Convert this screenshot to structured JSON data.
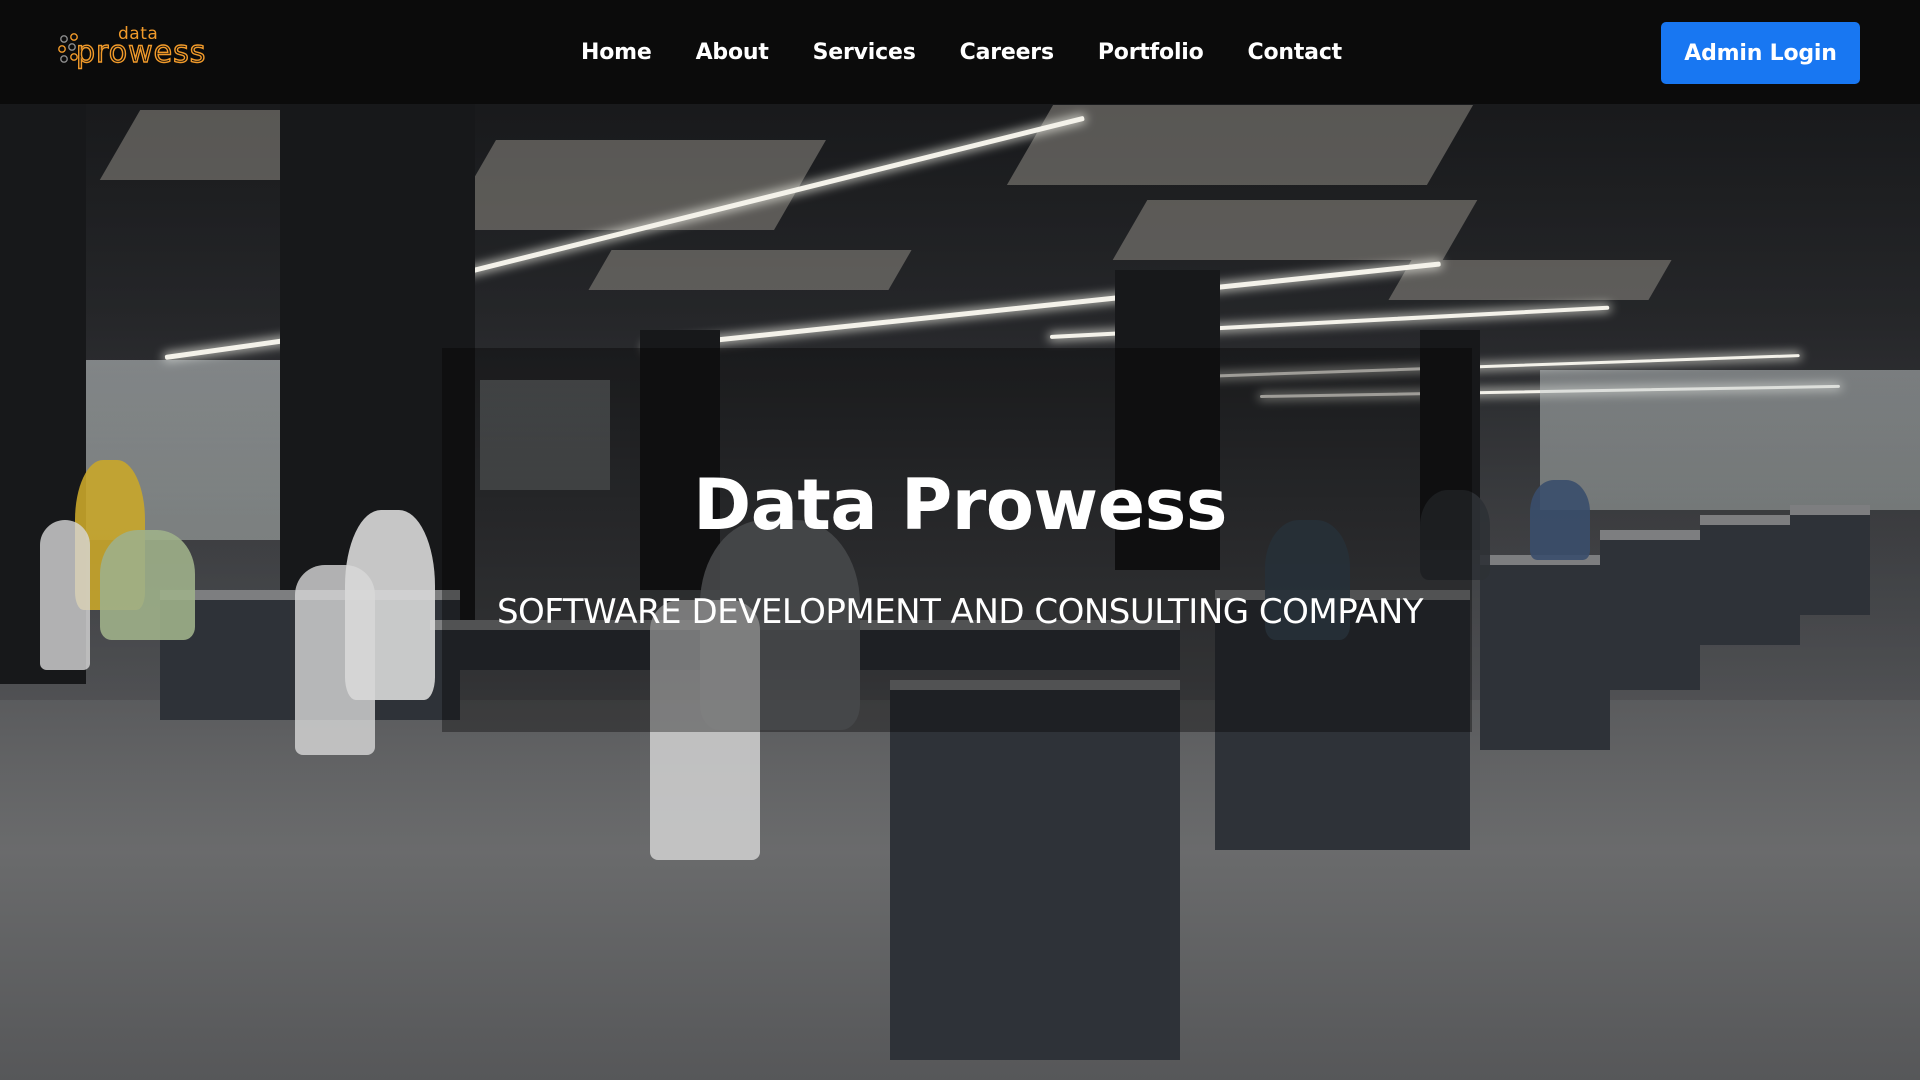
{
  "brand": {
    "small": "data",
    "big": "prowess",
    "accent_color": "#f19a2a",
    "icon": "dots-logo-icon"
  },
  "nav": {
    "items": [
      {
        "label": "Home"
      },
      {
        "label": "About"
      },
      {
        "label": "Services"
      },
      {
        "label": "Careers"
      },
      {
        "label": "Portfolio"
      },
      {
        "label": "Contact"
      }
    ],
    "admin_button": "Admin Login",
    "admin_button_color": "#1877f2",
    "background_color": "#0b0b0b"
  },
  "hero": {
    "title": "Data Prowess",
    "subtitle": "SOFTWARE DEVELOPMENT AND CONSULTING COMPANY"
  }
}
